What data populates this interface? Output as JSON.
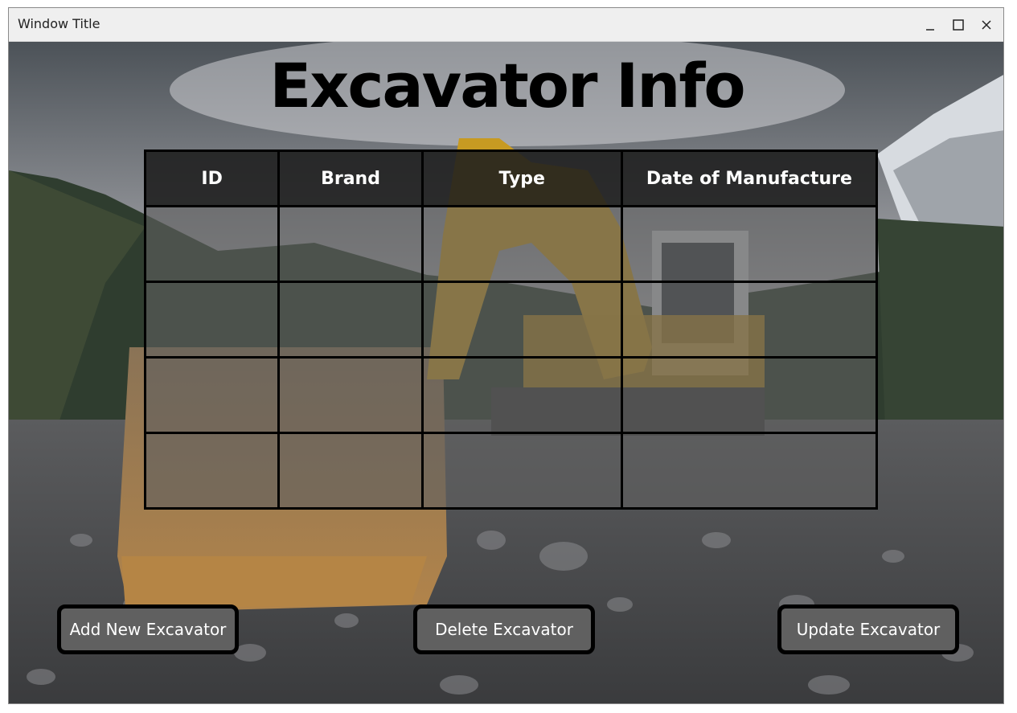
{
  "window": {
    "title": "Window Title"
  },
  "page": {
    "heading": "Excavator Info"
  },
  "table": {
    "columns": [
      "ID",
      "Brand",
      "Type",
      "Date of Manufacture"
    ],
    "rows": [
      [
        "",
        "",
        "",
        ""
      ],
      [
        "",
        "",
        "",
        ""
      ],
      [
        "",
        "",
        "",
        ""
      ],
      [
        "",
        "",
        "",
        ""
      ]
    ]
  },
  "buttons": {
    "add": "Add New Excavator",
    "delete": "Delete Excavator",
    "update": "Update Excavator"
  }
}
